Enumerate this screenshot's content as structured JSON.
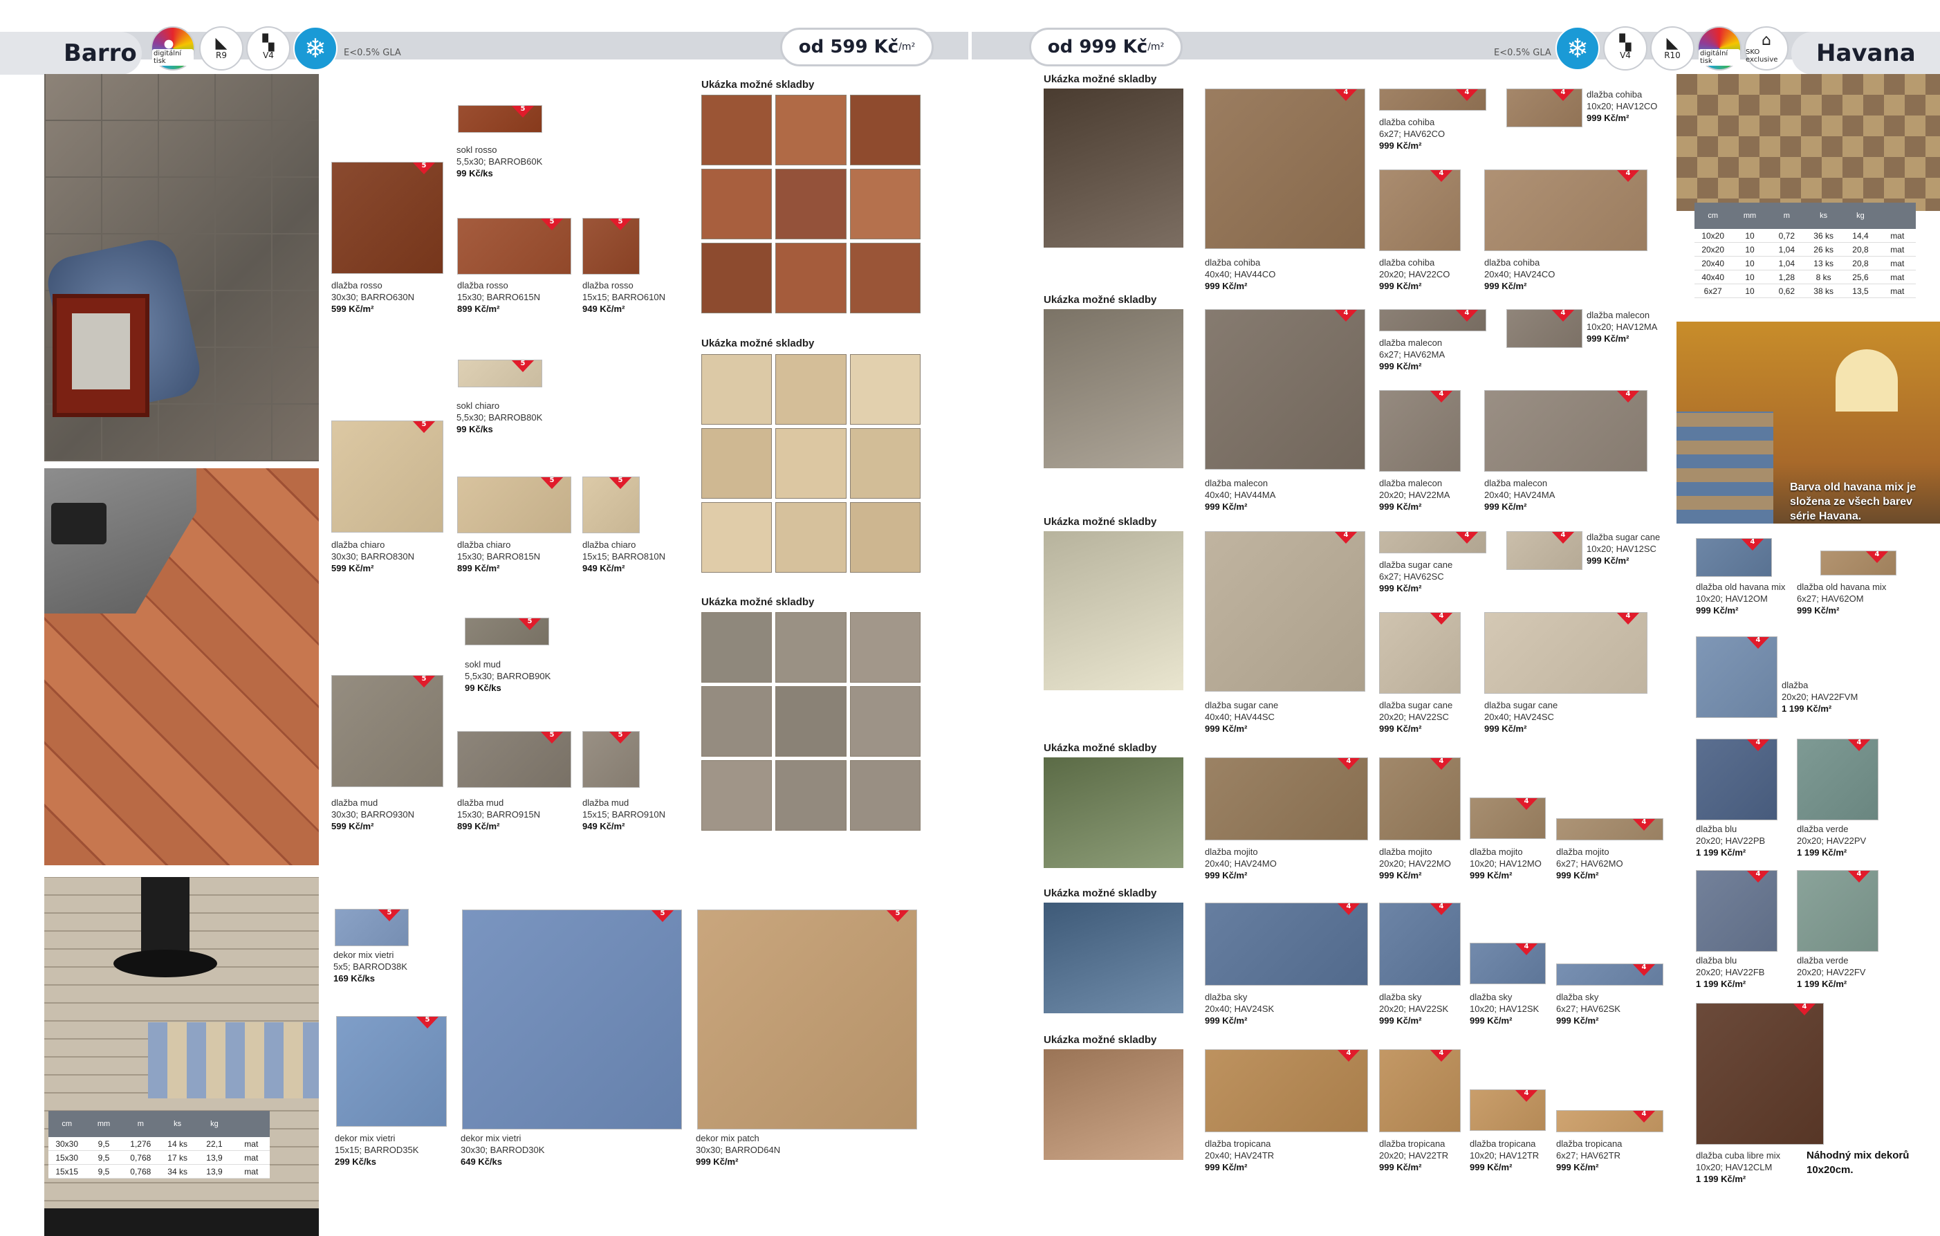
{
  "left": {
    "series": "Barro",
    "badges": {
      "digital": "digitální tisk",
      "slip": "R9",
      "variation": "V4"
    },
    "gla": "E<0.5% GLA",
    "price_from": "od 599 Kč",
    "price_unit": "/m²",
    "sample_heading": "Ukázka možné skladby",
    "products": [
      {
        "name": "sokl rosso",
        "code": "5,5x30; BARROB60K",
        "price": "99 Kč/ks"
      },
      {
        "name": "dlažba rosso",
        "code": "30x30; BARRO630N",
        "price": "599 Kč/m²"
      },
      {
        "name": "dlažba rosso",
        "code": "15x30; BARRO615N",
        "price": "899 Kč/m²"
      },
      {
        "name": "dlažba rosso",
        "code": "15x15; BARRO610N",
        "price": "949 Kč/m²"
      },
      {
        "name": "sokl chiaro",
        "code": "5,5x30; BARROB80K",
        "price": "99 Kč/ks"
      },
      {
        "name": "dlažba chiaro",
        "code": "30x30; BARRO830N",
        "price": "599 Kč/m²"
      },
      {
        "name": "dlažba chiaro",
        "code": "15x30; BARRO815N",
        "price": "899 Kč/m²"
      },
      {
        "name": "dlažba chiaro",
        "code": "15x15; BARRO810N",
        "price": "949 Kč/m²"
      },
      {
        "name": "sokl mud",
        "code": "5,5x30; BARROB90K",
        "price": "99 Kč/ks"
      },
      {
        "name": "dlažba mud",
        "code": "30x30; BARRO930N",
        "price": "599 Kč/m²"
      },
      {
        "name": "dlažba mud",
        "code": "15x30; BARRO915N",
        "price": "899 Kč/m²"
      },
      {
        "name": "dlažba mud",
        "code": "15x15; BARRO910N",
        "price": "949 Kč/m²"
      },
      {
        "name": "dekor mix vietri",
        "code": "5x5; BARROD38K",
        "price": "169 Kč/ks"
      },
      {
        "name": "dekor mix vietri",
        "code": "15x15; BARROD35K",
        "price": "299 Kč/ks"
      },
      {
        "name": "dekor mix vietri",
        "code": "30x30; BARROD30K",
        "price": "649 Kč/ks"
      },
      {
        "name": "dekor mix patch",
        "code": "30x30; BARROD64N",
        "price": "999 Kč/m²"
      }
    ],
    "spec": {
      "headers": [
        "cm",
        "mm",
        "m",
        "ks",
        "kg",
        ""
      ],
      "rows": [
        [
          "30x30",
          "9,5",
          "1,276",
          "14 ks",
          "22,1",
          "mat"
        ],
        [
          "15x30",
          "9,5",
          "0,768",
          "17 ks",
          "13,9",
          "mat"
        ],
        [
          "15x15",
          "9,5",
          "0,768",
          "34 ks",
          "13,9",
          "mat"
        ]
      ]
    }
  },
  "right": {
    "series": "Havana",
    "badges": {
      "slip": "R10",
      "variation": "V4",
      "digital": "digitální tisk",
      "sko": "SKO exclusive"
    },
    "gla": "E<0.5% GLA",
    "price_from": "od 999 Kč",
    "price_unit": "/m²",
    "sample_heading": "Ukázka možné skladby",
    "rows": [
      {
        "items": [
          {
            "name": "dlažba cohiba",
            "code": "40x40; HAV44CO",
            "price": "999 Kč/m²"
          },
          {
            "name": "dlažba cohiba",
            "code": "6x27; HAV62CO",
            "price": "999 Kč/m²"
          },
          {
            "name": "dlažba cohiba",
            "code": "10x20; HAV12CO",
            "price": "999 Kč/m²"
          },
          {
            "name": "dlažba cohiba",
            "code": "20x20; HAV22CO",
            "price": "999 Kč/m²"
          },
          {
            "name": "dlažba cohiba",
            "code": "20x40; HAV24CO",
            "price": "999 Kč/m²"
          }
        ]
      },
      {
        "items": [
          {
            "name": "dlažba malecon",
            "code": "40x40; HAV44MA",
            "price": "999 Kč/m²"
          },
          {
            "name": "dlažba malecon",
            "code": "6x27; HAV62MA",
            "price": "999 Kč/m²"
          },
          {
            "name": "dlažba malecon",
            "code": "10x20; HAV12MA",
            "price": "999 Kč/m²"
          },
          {
            "name": "dlažba malecon",
            "code": "20x20; HAV22MA",
            "price": "999 Kč/m²"
          },
          {
            "name": "dlažba malecon",
            "code": "20x40; HAV24MA",
            "price": "999 Kč/m²"
          }
        ]
      },
      {
        "items": [
          {
            "name": "dlažba sugar cane",
            "code": "40x40; HAV44SC",
            "price": "999 Kč/m²"
          },
          {
            "name": "dlažba sugar cane",
            "code": "6x27; HAV62SC",
            "price": "999 Kč/m²"
          },
          {
            "name": "dlažba sugar cane",
            "code": "10x20; HAV12SC",
            "price": "999 Kč/m²"
          },
          {
            "name": "dlažba sugar cane",
            "code": "20x20; HAV22SC",
            "price": "999 Kč/m²"
          },
          {
            "name": "dlažba sugar cane",
            "code": "20x40; HAV24SC",
            "price": "999 Kč/m²"
          }
        ]
      },
      {
        "items": [
          {
            "name": "dlažba mojito",
            "code": "20x40; HAV24MO",
            "price": "999 Kč/m²"
          },
          {
            "name": "dlažba mojito",
            "code": "20x20; HAV22MO",
            "price": "999 Kč/m²"
          },
          {
            "name": "dlažba mojito",
            "code": "10x20; HAV12MO",
            "price": "999 Kč/m²"
          },
          {
            "name": "dlažba mojito",
            "code": "6x27; HAV62MO",
            "price": "999 Kč/m²"
          }
        ]
      },
      {
        "items": [
          {
            "name": "dlažba sky",
            "code": "20x40; HAV24SK",
            "price": "999 Kč/m²"
          },
          {
            "name": "dlažba sky",
            "code": "20x20; HAV22SK",
            "price": "999 Kč/m²"
          },
          {
            "name": "dlažba sky",
            "code": "10x20; HAV12SK",
            "price": "999 Kč/m²"
          },
          {
            "name": "dlažba sky",
            "code": "6x27; HAV62SK",
            "price": "999 Kč/m²"
          }
        ]
      },
      {
        "items": [
          {
            "name": "dlažba tropicana",
            "code": "20x40; HAV24TR",
            "price": "999 Kč/m²"
          },
          {
            "name": "dlažba tropicana",
            "code": "20x20; HAV22TR",
            "price": "999 Kč/m²"
          },
          {
            "name": "dlažba tropicana",
            "code": "10x20; HAV12TR",
            "price": "999 Kč/m²"
          },
          {
            "name": "dlažba tropicana",
            "code": "6x27; HAV62TR",
            "price": "999 Kč/m²"
          }
        ]
      }
    ],
    "decor": [
      {
        "name": "dlažba old havana mix",
        "code": "10x20; HAV12OM",
        "price": "999 Kč/m²"
      },
      {
        "name": "dlažba old havana mix",
        "code": "6x27; HAV62OM",
        "price": "999 Kč/m²"
      },
      {
        "name": "dlažba",
        "code": "20x20; HAV22FVM",
        "price": "1 199 Kč/m²"
      },
      {
        "name": "dlažba blu",
        "code": "20x20; HAV22PB",
        "price": "1 199 Kč/m²"
      },
      {
        "name": "dlažba verde",
        "code": "20x20; HAV22PV",
        "price": "1 199 Kč/m²"
      },
      {
        "name": "dlažba blu",
        "code": "20x20; HAV22FB",
        "price": "1 199 Kč/m²"
      },
      {
        "name": "dlažba verde",
        "code": "20x20; HAV22FV",
        "price": "1 199 Kč/m²"
      },
      {
        "name": "dlažba cuba libre mix",
        "code": "10x20; HAV12CLM",
        "price": "1 199 Kč/m²"
      }
    ],
    "caption_old": "Barva old havana mix je složena ze všech barev série Havana.",
    "caption_mix": "Náhodný mix dekorů 10x20cm.",
    "spec": {
      "headers": [
        "cm",
        "mm",
        "m",
        "ks",
        "kg",
        ""
      ],
      "rows": [
        [
          "10x20",
          "10",
          "0,72",
          "36 ks",
          "14,4",
          "mat"
        ],
        [
          "20x20",
          "10",
          "1,04",
          "26 ks",
          "20,8",
          "mat"
        ],
        [
          "20x40",
          "10",
          "1,04",
          "13 ks",
          "20,8",
          "mat"
        ],
        [
          "40x40",
          "10",
          "1,28",
          "8 ks",
          "25,6",
          "mat"
        ],
        [
          "6x27",
          "10",
          "0,62",
          "38 ks",
          "13,5",
          "mat"
        ]
      ]
    }
  },
  "tag_number_left": "5",
  "tag_number_right": "4",
  "colors": {
    "accent_red": "#e11b2b",
    "snow_blue": "#1a9ad6",
    "header_grey": "#d5d8dd"
  }
}
